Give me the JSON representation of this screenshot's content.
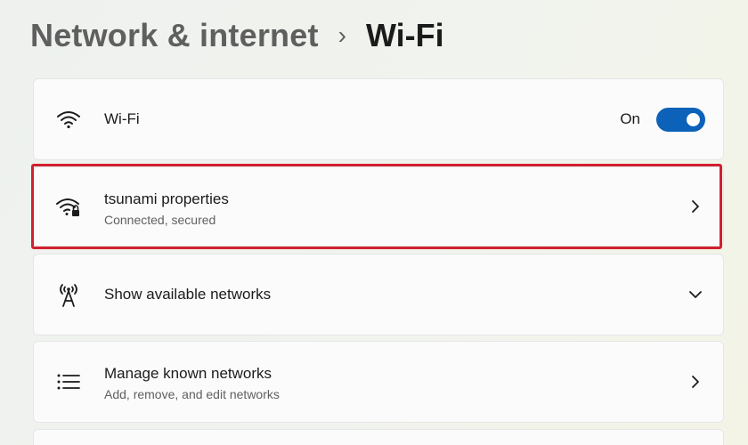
{
  "breadcrumb": {
    "parent": "Network & internet",
    "separator": "›",
    "current": "Wi-Fi"
  },
  "wifi_toggle": {
    "label": "Wi-Fi",
    "state_label": "On",
    "enabled": true,
    "icon": "wifi-icon"
  },
  "connected_network": {
    "name": "tsunami properties",
    "status": "Connected, secured",
    "icon": "wifi-secured-icon",
    "highlighted": true,
    "highlight_color": "#d2202f"
  },
  "available_networks": {
    "label": "Show available networks",
    "icon": "antenna-icon"
  },
  "known_networks": {
    "label": "Manage known networks",
    "description": "Add, remove, and edit networks",
    "icon": "list-icon"
  },
  "colors": {
    "accent": "#0b62b8",
    "highlight": "#d2202f"
  }
}
